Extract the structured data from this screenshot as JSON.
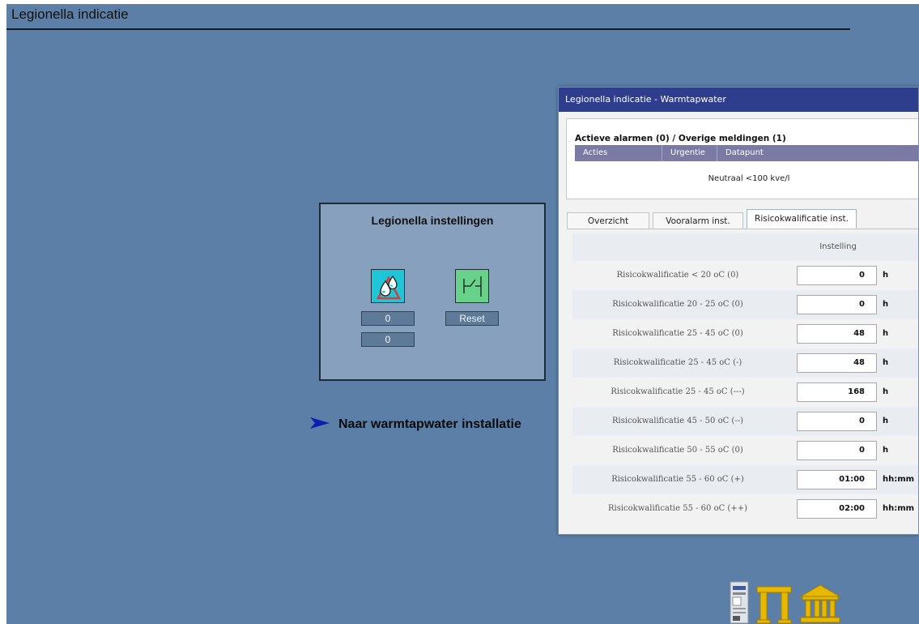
{
  "page": {
    "title": "Legionella indicatie"
  },
  "settings_panel": {
    "title": "Legionella instellingen",
    "water_icon": "water-drops-icon",
    "switch_icon": "switch-icon",
    "value_1": "0",
    "value_2": "0",
    "reset_label": "Reset"
  },
  "nav_link": {
    "label": "Naar warmtapwater installatie",
    "icon": "arrow-right-icon"
  },
  "dialog": {
    "title": "Legionella indicatie - Warmtapwater",
    "alarms": {
      "title": "Actieve alarmen (0) / Overige meldingen (1)",
      "columns": [
        "Acties",
        "Urgentie",
        "Datapunt"
      ],
      "message": "Neutraal <100 kve/l"
    },
    "tabs": [
      {
        "label": "Overzicht",
        "active": false
      },
      {
        "label": "Vooralarm inst.",
        "active": false
      },
      {
        "label": "Risicokwalificatie inst.",
        "active": true
      }
    ],
    "table": {
      "header": "Instelling",
      "rows": [
        {
          "label": "Risicokwalificatie   < 20 oC  (0)",
          "value": "0",
          "unit": "h"
        },
        {
          "label": "Risicokwalificatie 20 - 25 oC  (0)",
          "value": "0",
          "unit": "h"
        },
        {
          "label": "Risicokwalificatie 25 - 45 oC  (0)",
          "value": "48",
          "unit": "h"
        },
        {
          "label": "Risicokwalificatie 25 - 45 oC  (-)",
          "value": "48",
          "unit": "h"
        },
        {
          "label": "Risicokwalificatie 25 - 45 oC  (---)",
          "value": "168",
          "unit": "h"
        },
        {
          "label": "Risicokwalificatie 45 - 50 oC  (--)",
          "value": "0",
          "unit": "h"
        },
        {
          "label": "Risicokwalificatie 50 - 55 oC  (0)",
          "value": "0",
          "unit": "h"
        },
        {
          "label": "Risicokwalificatie 55 - 60 oC  (+)",
          "value": "01:00",
          "unit": "hh:mm"
        },
        {
          "label": "Risicokwalificatie 55 - 60 oC  (++)",
          "value": "02:00",
          "unit": "hh:mm"
        }
      ]
    }
  },
  "bottom_icons": [
    "device-panel-icon",
    "gateway-icon",
    "building-icon"
  ],
  "colors": {
    "background": "#5b7fa6",
    "panel": "#87a0bd",
    "titlebar": "#2f3e8c",
    "table_header": "#7a7aa4",
    "gold": "#e6b800"
  }
}
